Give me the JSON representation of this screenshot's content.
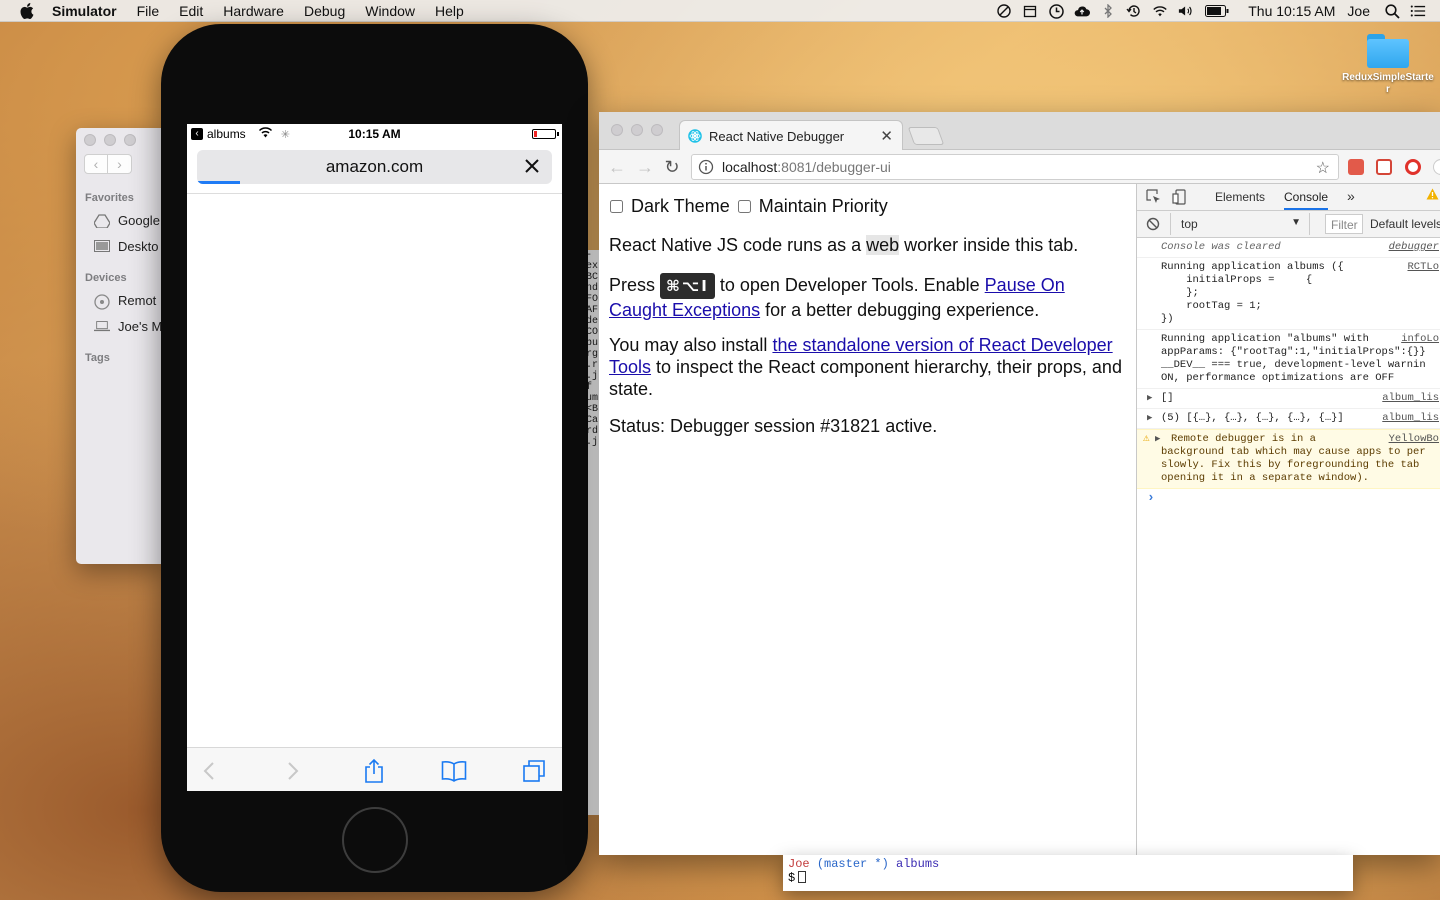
{
  "menubar": {
    "app_name": "Simulator",
    "menus": [
      "File",
      "Edit",
      "Hardware",
      "Debug",
      "Window",
      "Help"
    ],
    "clock": "Thu 10:15 AM",
    "user": "Joe",
    "icons": [
      "apple-icon",
      "do-not-disturb-icon",
      "files-icon",
      "time-icon",
      "cloud-upload-icon",
      "bluetooth-icon",
      "time-machine-icon",
      "wifi-icon",
      "volume-icon",
      "battery-icon",
      "spotlight-icon",
      "notification-center-icon"
    ]
  },
  "desktop": {
    "folder_label": "ReduxSimpleStarter"
  },
  "finder": {
    "favorites_label": "Favorites",
    "favorites": [
      "Google",
      "Deskto"
    ],
    "devices_label": "Devices",
    "devices": [
      "Remot",
      "Joe's M"
    ],
    "tags_label": "Tags"
  },
  "terminal_strip": [
    "-",
    "ex",
    "BC",
    "",
    "nd",
    "FO",
    "",
    "AF",
    "",
    "",
    "de",
    "",
    "",
    "",
    "",
    "CO",
    "",
    "",
    "bu",
    "rg",
    ".r",
    "",
    "",
    "",
    "",
    ".j",
    " f",
    "um",
    "",
    "",
    "",
    "<B",
    "Ca",
    "",
    "",
    "rd",
    "",
    "",
    ".j"
  ],
  "terminal": {
    "user": "Joe",
    "branch": "(master *)",
    "dir": "albums",
    "prompt": "$"
  },
  "phone": {
    "back_app": "albums",
    "time": "10:15 AM",
    "url": "amazon.com",
    "load_progress": 0.12
  },
  "chrome": {
    "tab_title": "React Native Debugger",
    "url_host": "localhost",
    "url_path": ":8081/debugger-ui",
    "accent": "#1a73e8"
  },
  "page": {
    "dark_theme_label": "Dark Theme",
    "maintain_priority_label": "Maintain Priority",
    "p1_pre": "React Native JS code runs as a ",
    "p1_hl": "web",
    "p1_post": " worker inside this tab.",
    "p2_pre": "Press ",
    "p2_kbd": "⌘⌥I",
    "p2_mid": " to open Developer Tools. Enable ",
    "p2_link": "Pause On Caught Exceptions",
    "p2_post": " for a better debugging experience.",
    "p3_pre": "You may also install ",
    "p3_link": "the standalone version of React Developer Tools",
    "p3_post": " to inspect the React component hierarchy, their props, and state.",
    "status": "Status: Debugger session #31821 active."
  },
  "devtools": {
    "tabs": [
      "Elements",
      "Console"
    ],
    "active_tab": "Console",
    "more": "»",
    "context": "top",
    "filter_placeholder": "Filter",
    "levels": "Default levels",
    "logs": [
      {
        "text": "Console was cleared",
        "src": "debugger",
        "kind": "italic"
      },
      {
        "text": "Running application albums ({\n    initialProps =     {\n    };\n    rootTag = 1;\n})",
        "src": "RCTLo",
        "kind": "log"
      },
      {
        "text": "Running application \"albums\" with\nappParams: {\"rootTag\":1,\"initialProps\":{}}\n__DEV__ === true, development-level warnin\nON, performance optimizations are OFF",
        "src": "infoLo",
        "kind": "log"
      },
      {
        "text": "[]",
        "src": "album_lis",
        "kind": "expand"
      },
      {
        "text": "(5) [{…}, {…}, {…}, {…}, {…}]",
        "src": "album_lis",
        "kind": "expand"
      },
      {
        "text": "Remote debugger is in a\nbackground tab which may cause apps to per\nslowly. Fix this by foregrounding the tab\nopening it in a separate window).",
        "src": "YellowBo",
        "kind": "warn"
      }
    ],
    "prompt": "›"
  }
}
